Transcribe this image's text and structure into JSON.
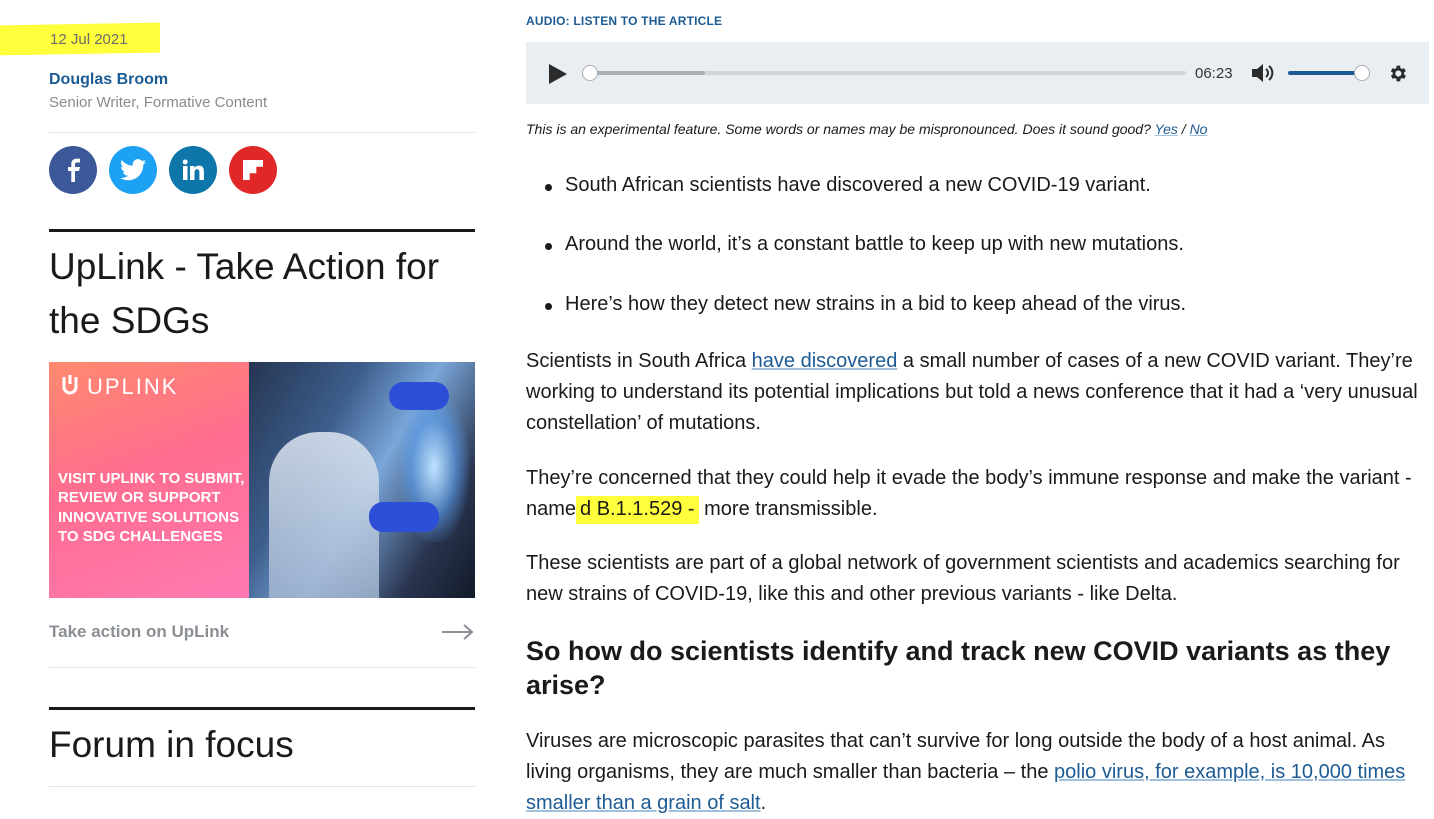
{
  "sidebar": {
    "date": "12 Jul 2021",
    "author_name": "Douglas Broom",
    "author_role": "Senior Writer, Formative Content",
    "share": [
      {
        "name": "facebook",
        "color": "#3b5998"
      },
      {
        "name": "twitter",
        "color": "#1da1f2"
      },
      {
        "name": "linkedin",
        "color": "#0e76a8"
      },
      {
        "name": "flipboard",
        "color": "#e12828"
      }
    ],
    "uplink_heading": "UpLink - Take Action for the SDGs",
    "banner": {
      "logo_text": "UPLINK",
      "cta_text": "VISIT UPLINK TO SUBMIT, REVIEW OR SUPPORT INNOVATIVE SOLUTIONS TO SDG CHALLENGES"
    },
    "take_action_link": "Take action on UpLink",
    "forum_heading": "Forum in focus"
  },
  "audio": {
    "label": "AUDIO: LISTEN TO THE ARTICLE",
    "duration": "06:23",
    "progress": 0,
    "volume": 1.0,
    "note_prefix": "This is an experimental feature. Some words or names may be mispronounced. Does it sound good?",
    "yes": "Yes",
    "separator": "/",
    "no": "No"
  },
  "article": {
    "bullets": [
      "South African scientists have discovered a new COVID-19 variant.",
      "Around the world, it’s a constant battle to keep up with new mutations.",
      "Here’s how they detect new strains in a bid to keep ahead of the virus."
    ],
    "p1_before": "Scientists in South Africa ",
    "p1_link": "have discovered",
    "p1_after": " a small number of cases of a new COVID variant. They’re working to understand its potential implications but told a news conference that it had a ‘very unusual constellation’ of mutations.",
    "p2_before": "They’re concerned that they could help it evade the body’s immune response and make the variant - name",
    "p2_highlight": "d B.1.1.529 -",
    "p2_after": " more transmissible.",
    "p3": "These scientists are part of a global network of government scientists and academics searching for new strains of COVID-19, like this and other previous variants - like Delta.",
    "heading": "So how do scientists identify and track new COVID variants as they arise?",
    "p4_before": "Viruses are microscopic parasites that can’t survive for long outside the body of a host animal. As living organisms, they are much smaller than bacteria – the ",
    "p4_link": "polio virus, for example, is 10,000 times smaller than a grain of salt",
    "p4_after": "."
  },
  "colors": {
    "link_blue": "#1d5b94",
    "highlight_yellow": "#ffff3c",
    "player_bg": "#e9eef2"
  }
}
